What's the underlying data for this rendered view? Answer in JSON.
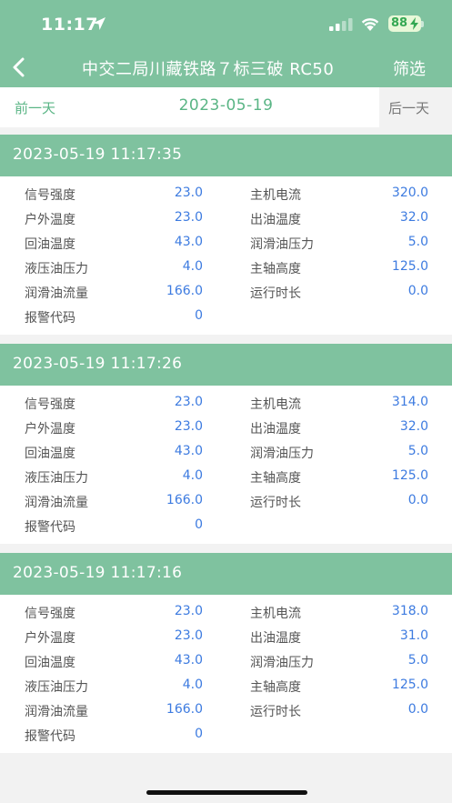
{
  "status_bar": {
    "time": "11:17",
    "battery": "88"
  },
  "nav": {
    "title": "中交二局川藏铁路７标三破 RC50",
    "filter_label": "筛选"
  },
  "date_bar": {
    "prev_label": "前一天",
    "current_date": "2023-05-19",
    "next_label": "后一天"
  },
  "records": [
    {
      "timestamp": "2023-05-19 11:17:35",
      "left": [
        {
          "label": "信号强度",
          "value": "23.0"
        },
        {
          "label": "户外温度",
          "value": "23.0"
        },
        {
          "label": "回油温度",
          "value": "43.0"
        },
        {
          "label": "液压油压力",
          "value": "4.0"
        },
        {
          "label": "润滑油流量",
          "value": "166.0"
        },
        {
          "label": "报警代码",
          "value": "0"
        }
      ],
      "right": [
        {
          "label": "主机电流",
          "value": "320.0"
        },
        {
          "label": "出油温度",
          "value": "32.0"
        },
        {
          "label": "润滑油压力",
          "value": "5.0"
        },
        {
          "label": "主轴高度",
          "value": "125.0"
        },
        {
          "label": "运行时长",
          "value": "0.0"
        }
      ]
    },
    {
      "timestamp": "2023-05-19 11:17:26",
      "left": [
        {
          "label": "信号强度",
          "value": "23.0"
        },
        {
          "label": "户外温度",
          "value": "23.0"
        },
        {
          "label": "回油温度",
          "value": "43.0"
        },
        {
          "label": "液压油压力",
          "value": "4.0"
        },
        {
          "label": "润滑油流量",
          "value": "166.0"
        },
        {
          "label": "报警代码",
          "value": "0"
        }
      ],
      "right": [
        {
          "label": "主机电流",
          "value": "314.0"
        },
        {
          "label": "出油温度",
          "value": "32.0"
        },
        {
          "label": "润滑油压力",
          "value": "5.0"
        },
        {
          "label": "主轴高度",
          "value": "125.0"
        },
        {
          "label": "运行时长",
          "value": "0.0"
        }
      ]
    },
    {
      "timestamp": "2023-05-19 11:17:16",
      "left": [
        {
          "label": "信号强度",
          "value": "23.0"
        },
        {
          "label": "户外温度",
          "value": "23.0"
        },
        {
          "label": "回油温度",
          "value": "43.0"
        },
        {
          "label": "液压油压力",
          "value": "4.0"
        },
        {
          "label": "润滑油流量",
          "value": "166.0"
        },
        {
          "label": "报警代码",
          "value": "0"
        }
      ],
      "right": [
        {
          "label": "主机电流",
          "value": "318.0"
        },
        {
          "label": "出油温度",
          "value": "31.0"
        },
        {
          "label": "润滑油压力",
          "value": "5.0"
        },
        {
          "label": "主轴高度",
          "value": "125.0"
        },
        {
          "label": "运行时长",
          "value": "0.0"
        }
      ]
    }
  ],
  "colors": {
    "accent": "#7fc29f",
    "value_text": "#3d7be0",
    "label_text": "#555555"
  }
}
